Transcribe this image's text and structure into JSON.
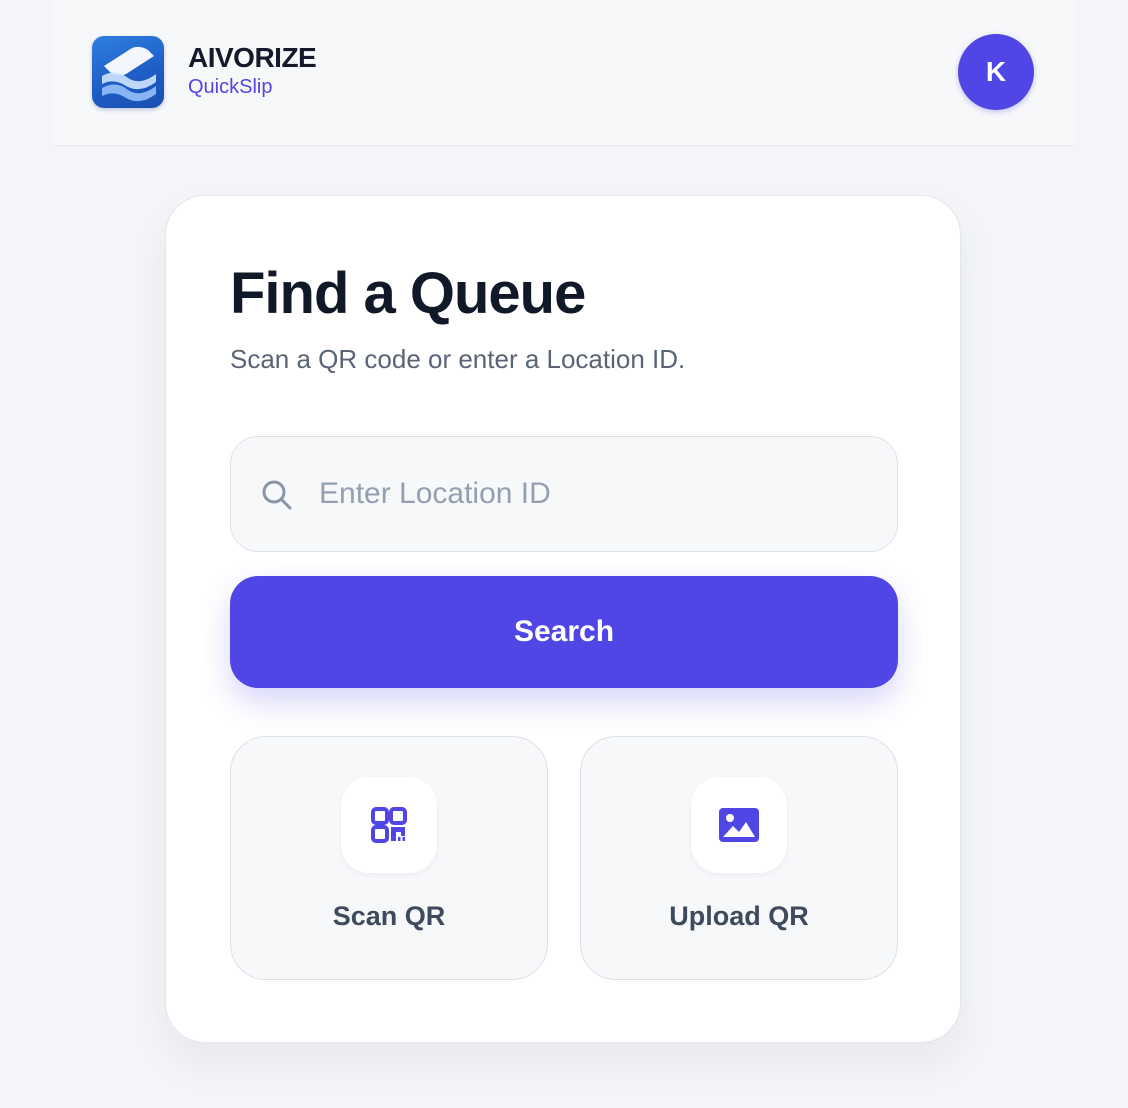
{
  "header": {
    "brand_title": "AIVORIZE",
    "brand_subtitle": "QuickSlip",
    "avatar_initial": "K",
    "logo_icon": "layers-icon"
  },
  "main": {
    "title": "Find a Queue",
    "subtitle": "Scan a QR code or enter a Location ID.",
    "search": {
      "placeholder": "Enter Location ID",
      "value": "",
      "icon": "search-icon"
    },
    "search_button_label": "Search",
    "actions": [
      {
        "label": "Scan QR",
        "icon": "qr-code-icon"
      },
      {
        "label": "Upload QR",
        "icon": "image-icon"
      }
    ]
  },
  "colors": {
    "accent": "#4f46e5",
    "background": "#f4f5f8",
    "card": "#ffffff",
    "title_text": "#111827",
    "muted_text": "#5a6475"
  }
}
